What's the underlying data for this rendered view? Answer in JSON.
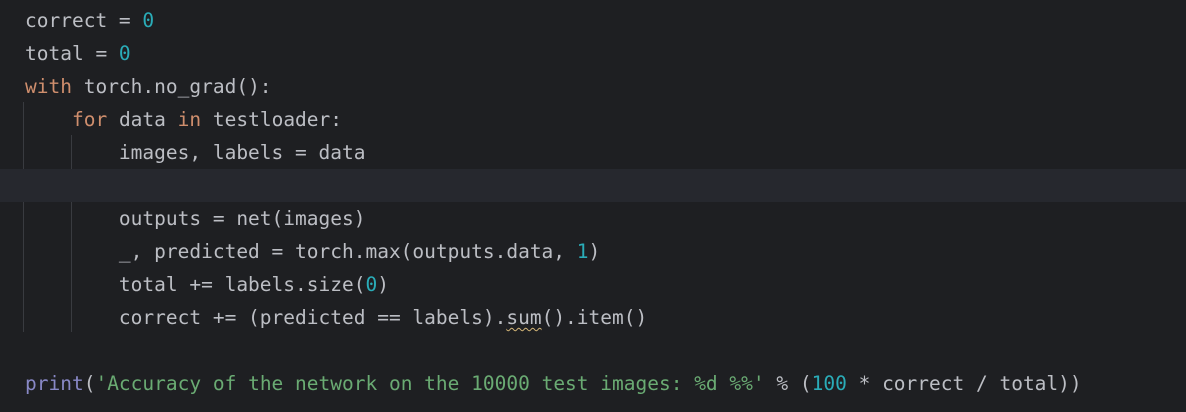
{
  "editor": {
    "lines": [
      [
        {
          "t": "correct = ",
          "c": "plain"
        },
        {
          "t": "0",
          "c": "num"
        }
      ],
      [
        {
          "t": "total = ",
          "c": "plain"
        },
        {
          "t": "0",
          "c": "num"
        }
      ],
      [
        {
          "t": "with",
          "c": "kw"
        },
        {
          "t": " torch.no_grad():",
          "c": "plain"
        }
      ],
      [
        {
          "t": "    ",
          "c": "plain"
        },
        {
          "t": "for",
          "c": "kw"
        },
        {
          "t": " data ",
          "c": "plain"
        },
        {
          "t": "in",
          "c": "kw"
        },
        {
          "t": " testloader:",
          "c": "plain"
        }
      ],
      [
        {
          "t": "        images, labels = data",
          "c": "plain"
        }
      ],
      [],
      [
        {
          "t": "        outputs = net(images)",
          "c": "plain"
        }
      ],
      [
        {
          "t": "        _, predicted = torch.max(outputs.data, ",
          "c": "plain"
        },
        {
          "t": "1",
          "c": "num"
        },
        {
          "t": ")",
          "c": "plain"
        }
      ],
      [
        {
          "t": "        total += labels.size(",
          "c": "plain"
        },
        {
          "t": "0",
          "c": "num"
        },
        {
          "t": ")",
          "c": "plain"
        }
      ],
      [
        {
          "t": "        correct += (predicted == labels).",
          "c": "plain"
        },
        {
          "t": "sum",
          "c": "warn"
        },
        {
          "t": "().item()",
          "c": "plain"
        }
      ],
      [],
      [
        {
          "t": "print",
          "c": "builtin"
        },
        {
          "t": "(",
          "c": "plain"
        },
        {
          "t": "'Accuracy of the network on the 10000 test images: %d %%'",
          "c": "str"
        },
        {
          "t": " % (",
          "c": "plain"
        },
        {
          "t": "100",
          "c": "num"
        },
        {
          "t": " * correct / total))",
          "c": "plain"
        }
      ]
    ],
    "current_line": 5
  },
  "colors": {
    "background": "#1e1f22",
    "current_line": "#26282e",
    "text": "#bcbec4",
    "keyword": "#cf8e6d",
    "number": "#2aacb8",
    "string": "#6aab73",
    "builtin": "#8888c6",
    "warning_underline": "#d5b778",
    "indent_guide": "#393b40"
  }
}
